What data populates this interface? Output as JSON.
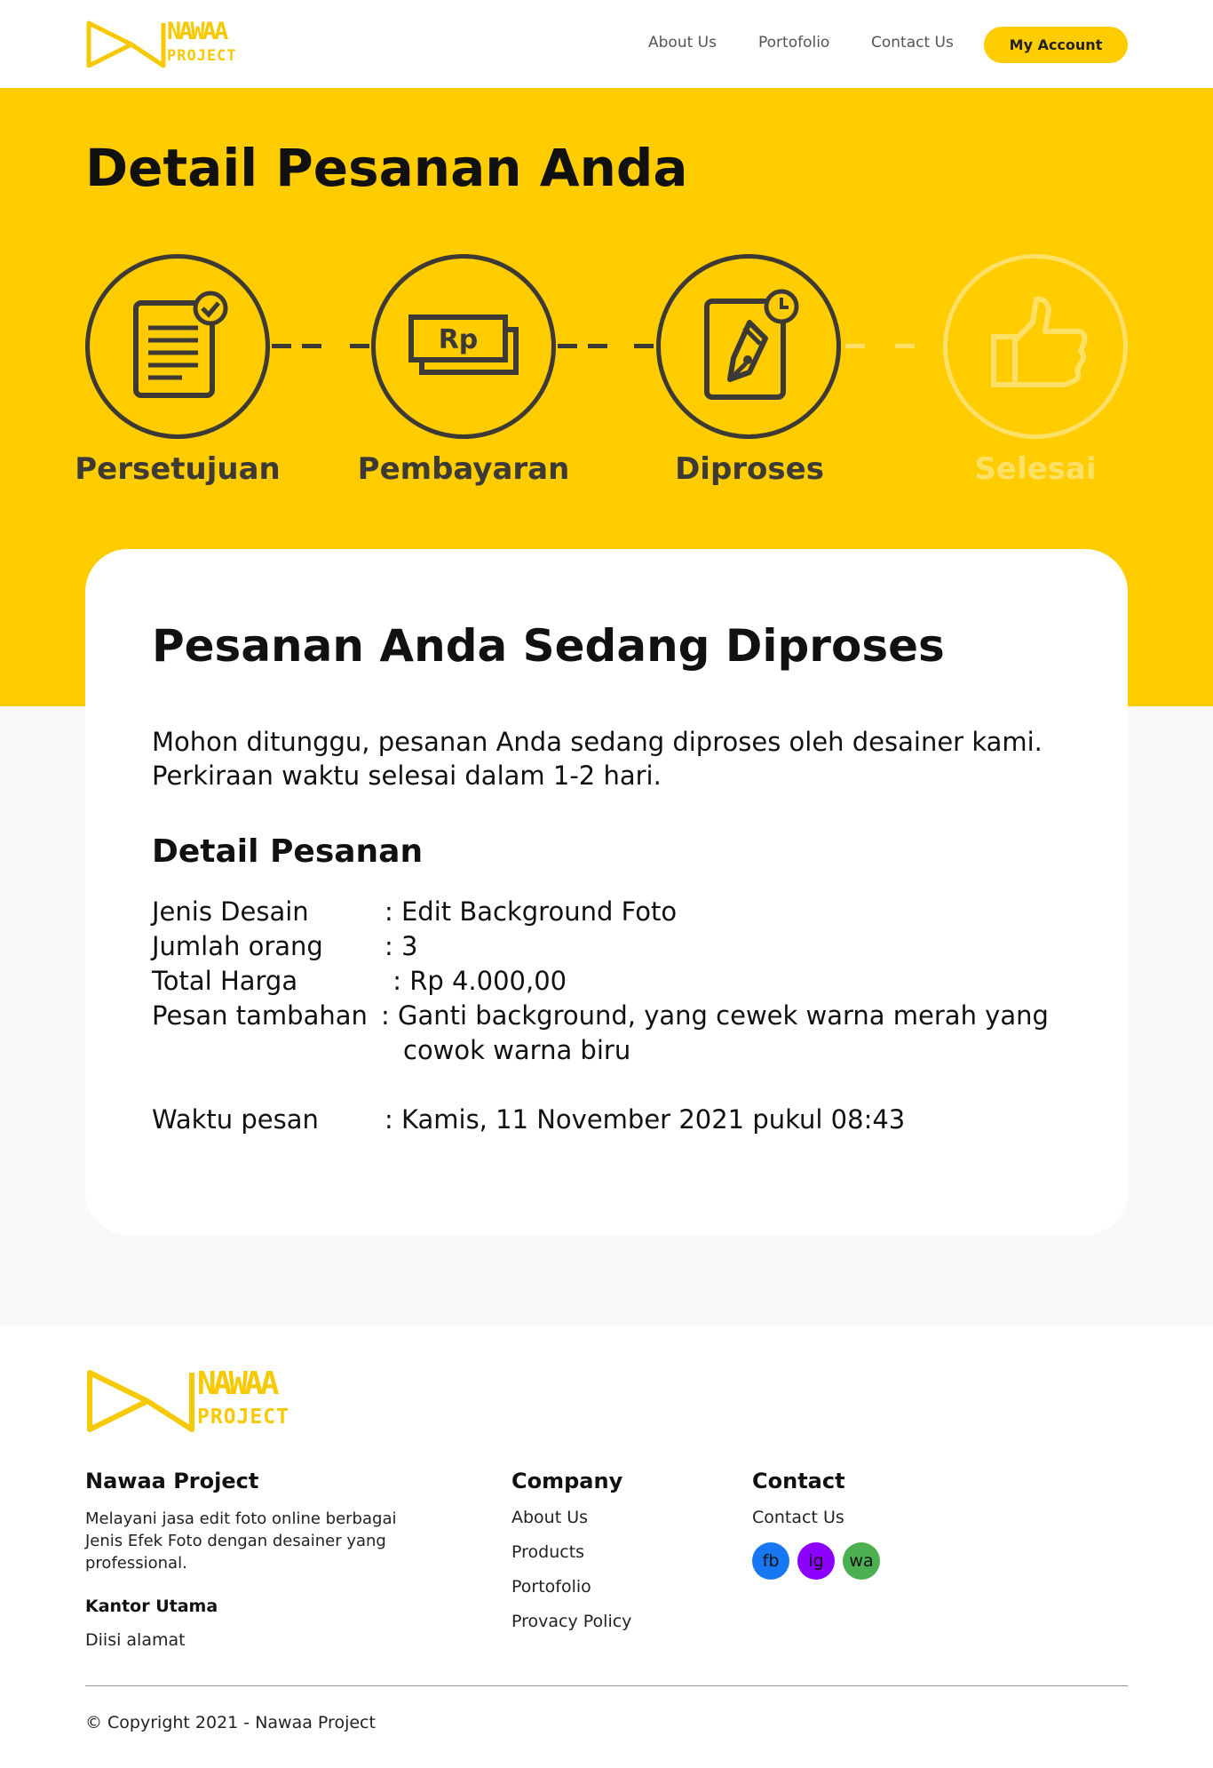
{
  "header": {
    "logo": {
      "line1": "NAWAA",
      "line2": "PROJECT"
    },
    "nav": [
      {
        "label": "About Us"
      },
      {
        "label": "Portofolio"
      },
      {
        "label": "Contact Us"
      }
    ],
    "account_label": "My Account"
  },
  "hero": {
    "title": "Detail Pesanan Anda",
    "steps": [
      {
        "label": "Persetujuan",
        "icon": "document-check-icon",
        "state": "done"
      },
      {
        "label": "Pembayaran",
        "icon": "money-rp-icon",
        "state": "done"
      },
      {
        "label": "Diproses",
        "icon": "pen-clock-icon",
        "state": "active"
      },
      {
        "label": "Selesai",
        "icon": "thumbs-up-icon",
        "state": "pending"
      }
    ],
    "payment_icon_text": "Rp"
  },
  "card": {
    "title": "Pesanan Anda Sedang Diproses",
    "message_line1": "Mohon ditunggu, pesanan Anda sedang diproses oleh desainer kami.",
    "message_line2": "Perkiraan waktu selesai dalam 1-2 hari.",
    "subtitle": "Detail Pesanan",
    "details": [
      {
        "key": "Jenis Desain",
        "value": ": Edit Background Foto"
      },
      {
        "key": "Jumlah orang",
        "value": ": 3"
      },
      {
        "key": "Total Harga",
        "value": " : Rp 4.000,00"
      },
      {
        "key": "Pesan tambahan",
        "value": ": Ganti background, yang cewek warna merah yang"
      }
    ],
    "details_continuation": "cowok warna biru",
    "order_time": {
      "key": "Waktu pesan",
      "value": ": Kamis, 11 November 2021 pukul 08:43"
    }
  },
  "footer": {
    "logo": {
      "line1": "NAWAA",
      "line2": "PROJECT"
    },
    "brand_heading": "Nawaa Project",
    "description": "Melayani jasa edit foto online berbagai Jenis Efek Foto dengan desainer yang professional.",
    "office_heading": "Kantor Utama",
    "address": "Diisi alamat",
    "company_heading": "Company",
    "company_links": [
      "About Us",
      "Products",
      "Portofolio",
      "Provacy Policy"
    ],
    "contact_heading": "Contact",
    "contact_link": "Contact Us",
    "social": [
      {
        "label": "fb",
        "color": "#1877f2"
      },
      {
        "label": "ig",
        "color": "#8b00ff"
      },
      {
        "label": "wa",
        "color": "#4caf50"
      }
    ],
    "copyright": "© Copyright 2021 - Nawaa Project"
  },
  "colors": {
    "accent": "#ffcc00",
    "step_done": "#3d3a35",
    "step_pending": "#ffe066"
  }
}
